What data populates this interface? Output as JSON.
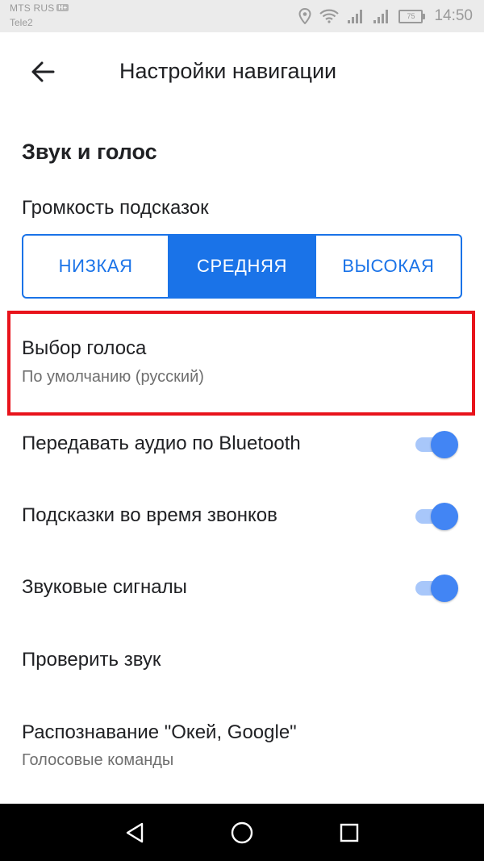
{
  "status_bar": {
    "carrier_primary": "MTS RUS",
    "network_badge": "H+",
    "carrier_secondary": "Tele2",
    "battery_level": "75",
    "time": "14:50",
    "icons": [
      "location-icon",
      "wifi-icon",
      "signal-icon",
      "signal-icon",
      "battery-icon"
    ]
  },
  "app_bar": {
    "back_icon": "arrow-left-icon",
    "title": "Настройки навигации"
  },
  "section": {
    "heading": "Звук и голос"
  },
  "volume": {
    "label": "Громкость подсказок",
    "options": [
      "НИЗКАЯ",
      "СРЕДНЯЯ",
      "ВЫСОКАЯ"
    ],
    "selected": "СРЕДНЯЯ"
  },
  "voice": {
    "title": "Выбор голоса",
    "subtitle": "По умолчанию (русский)"
  },
  "toggles": [
    {
      "label": "Передавать аудио по Bluetooth",
      "enabled": true
    },
    {
      "label": "Подсказки во время звонков",
      "enabled": true
    },
    {
      "label": "Звуковые сигналы",
      "enabled": true
    }
  ],
  "check_sound": {
    "label": "Проверить звук"
  },
  "ok_google": {
    "title": "Распознавание \"Окей, Google\"",
    "subtitle": "Голосовые команды"
  },
  "nav_bar": {
    "icons": [
      "back-triangle-icon",
      "home-circle-icon",
      "recents-square-icon"
    ]
  },
  "colors": {
    "accent": "#1a73e8",
    "highlight_border": "#e8131b",
    "toggle_thumb": "#4285f4",
    "toggle_track": "#a8c7fa"
  }
}
